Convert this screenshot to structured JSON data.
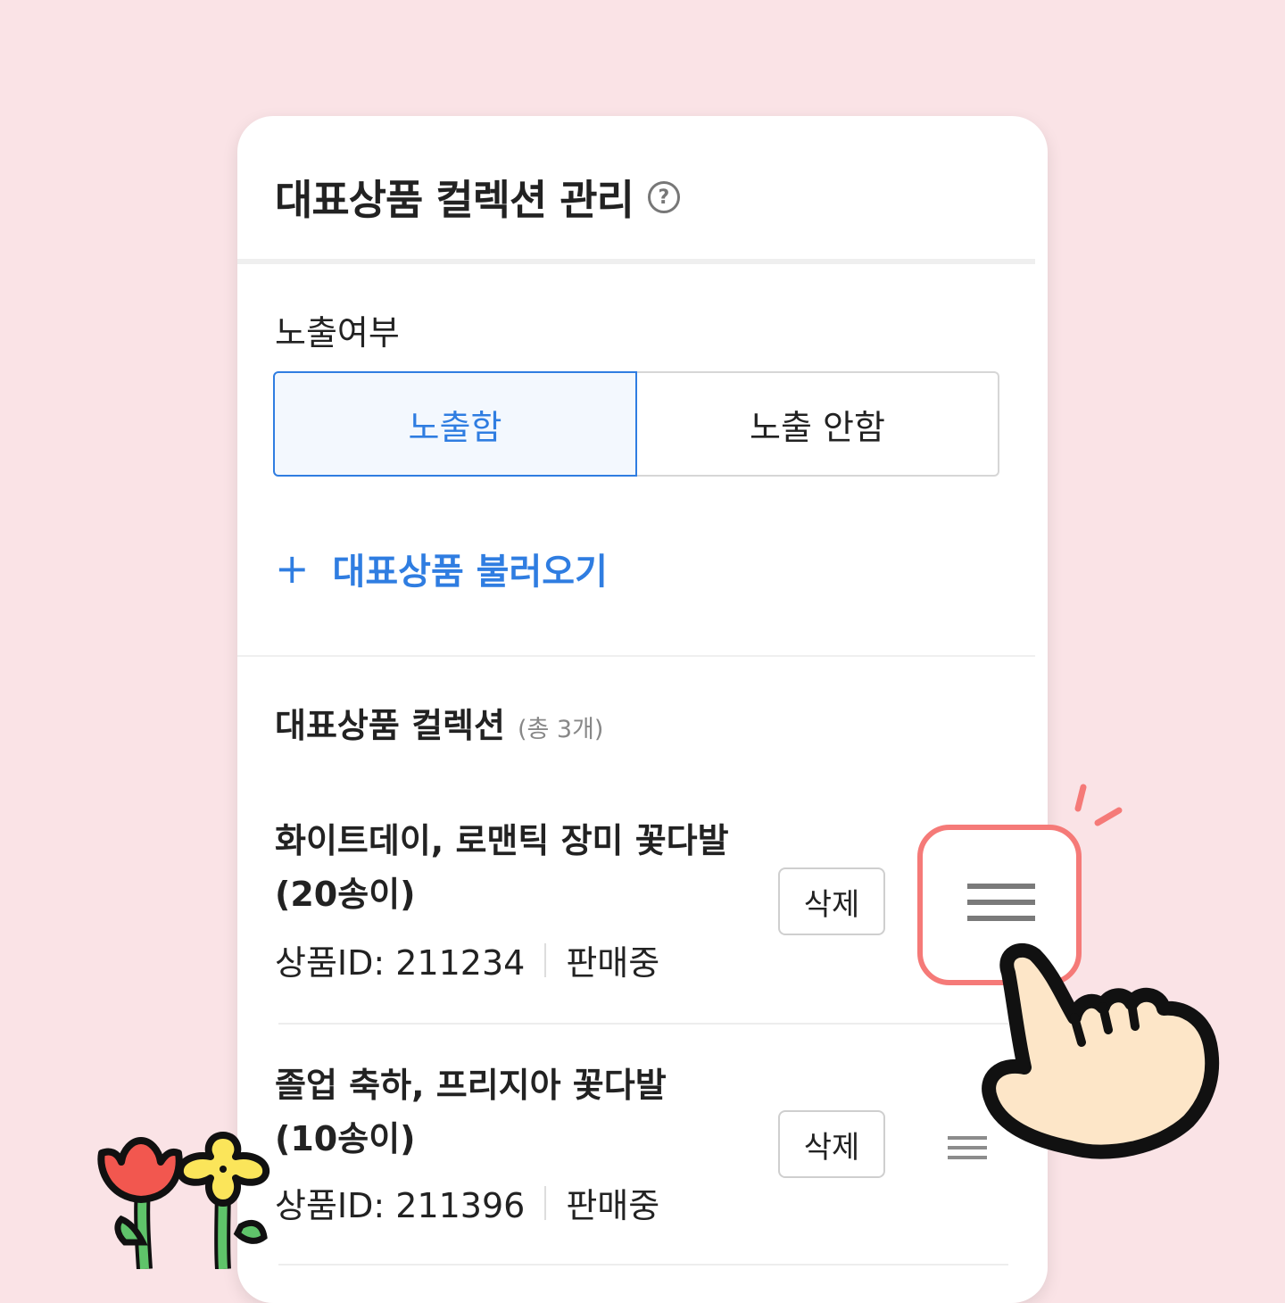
{
  "header": {
    "title": "대표상품 컬렉션 관리",
    "help_icon": "?"
  },
  "visibility": {
    "label": "노출여부",
    "options": [
      "노출함",
      "노출 안함"
    ],
    "selected": "노출함"
  },
  "add_button": {
    "icon": "+",
    "label": "대표상품 불러오기"
  },
  "collection": {
    "title": "대표상품 컬렉션",
    "count": "(총 3개)",
    "items": [
      {
        "name_line1": "화이트데이, 로맨틱 장미 꽃다발",
        "name_line2": "(20송이)",
        "product_id": "상품ID: 211234",
        "status": "판매중",
        "delete_label": "삭제"
      },
      {
        "name_line1": "졸업 축하, 프리지아 꽃다발",
        "name_line2": "(10송이)",
        "product_id": "상품ID: 211396",
        "status": "판매중",
        "delete_label": "삭제"
      }
    ]
  },
  "colors": {
    "accent": "#2f7de1",
    "highlight": "#f57a78",
    "background": "#fae3e6"
  },
  "decorations": [
    "drag-handle-highlight",
    "pointing-hand-icon",
    "flowers-illustration"
  ]
}
